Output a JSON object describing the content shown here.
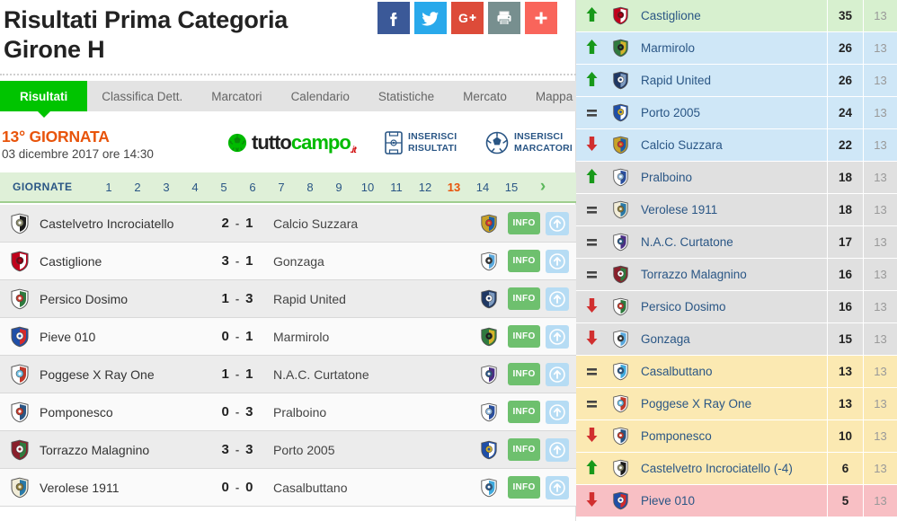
{
  "header": {
    "title_line1": "Risultati Prima Categoria",
    "title_line2": "Girone H",
    "social": [
      {
        "name": "facebook",
        "label": "f"
      },
      {
        "name": "twitter",
        "label": ""
      },
      {
        "name": "googleplus",
        "label": "G+"
      },
      {
        "name": "print",
        "label": ""
      },
      {
        "name": "share-more",
        "label": "+"
      }
    ]
  },
  "tabs": [
    {
      "label": "Risultati",
      "active": true
    },
    {
      "label": "Classifica Dett.",
      "active": false
    },
    {
      "label": "Marcatori",
      "active": false
    },
    {
      "label": "Calendario",
      "active": false
    },
    {
      "label": "Statistiche",
      "active": false
    },
    {
      "label": "Mercato",
      "active": false
    },
    {
      "label": "Mappa",
      "active": false
    }
  ],
  "matchday": {
    "number_label": "13° GIORNATA",
    "date_label": "03 dicembre 2017 ore 14:30",
    "logo_text_1": "tutto",
    "logo_text_2": "campo",
    "logo_suffix": ".it",
    "insert_results_line1": "INSERISCI",
    "insert_results_line2": "RISULTATI",
    "insert_scorers_line1": "INSERISCI",
    "insert_scorers_line2": "MARCATORI"
  },
  "giornate": {
    "label": "GIORNATE",
    "numbers": [
      "1",
      "2",
      "3",
      "4",
      "5",
      "6",
      "7",
      "8",
      "9",
      "10",
      "11",
      "12",
      "13",
      "14",
      "15"
    ],
    "current": "13",
    "next_icon": "›"
  },
  "matches": [
    {
      "home": "Castelvetro Incrociatello",
      "home_score": "2",
      "away_score": "1",
      "away": "Calcio Suzzara",
      "home_logo": {
        "c1": "#ffffff",
        "c2": "#1b1b1b",
        "c3": "#8a8a6a"
      },
      "away_logo": {
        "c1": "#c9a227",
        "c2": "#1b5fa8",
        "c3": "#d03030"
      },
      "info_label": "INFO"
    },
    {
      "home": "Castiglione",
      "home_score": "3",
      "away_score": "1",
      "away": "Gonzaga",
      "home_logo": {
        "c1": "#c2001b",
        "c2": "#ffffff",
        "c3": "#7a0010"
      },
      "away_logo": {
        "c1": "#ffffff",
        "c2": "#5aa9dd",
        "c3": "#333333"
      },
      "info_label": "INFO"
    },
    {
      "home": "Persico Dosimo",
      "home_score": "1",
      "away_score": "3",
      "away": "Rapid United",
      "home_logo": {
        "c1": "#ffffff",
        "c2": "#2f7a3e",
        "c3": "#c0392b"
      },
      "away_logo": {
        "c1": "#1f3864",
        "c2": "#7f9cc0",
        "c3": "#ffffff"
      },
      "info_label": "INFO"
    },
    {
      "home": "Pieve 010",
      "home_score": "0",
      "away_score": "1",
      "away": "Marmirolo",
      "home_logo": {
        "c1": "#1f4fa8",
        "c2": "#d42b2b",
        "c3": "#ffffff"
      },
      "away_logo": {
        "c1": "#2f7a3e",
        "c2": "#d4b32a",
        "c3": "#1b1b1b"
      },
      "info_label": "INFO"
    },
    {
      "home": "Poggese X Ray One",
      "home_score": "1",
      "away_score": "1",
      "away": "N.A.C. Curtatone",
      "home_logo": {
        "c1": "#ffffff",
        "c2": "#c0392b",
        "c3": "#6fc2e8"
      },
      "away_logo": {
        "c1": "#ffffff",
        "c2": "#4b2f86",
        "c3": "#2a5685"
      },
      "info_label": "INFO"
    },
    {
      "home": "Pomponesco",
      "home_score": "0",
      "away_score": "3",
      "away": "Pralboino",
      "home_logo": {
        "c1": "#ffffff",
        "c2": "#2a5685",
        "c3": "#c0392b"
      },
      "away_logo": {
        "c1": "#ffffff",
        "c2": "#2a4f9e",
        "c3": "#8fb8dd"
      },
      "info_label": "INFO"
    },
    {
      "home": "Torrazzo Malagnino",
      "home_score": "3",
      "away_score": "3",
      "away": "Porto 2005",
      "home_logo": {
        "c1": "#8a1f2b",
        "c2": "#2f7a3e",
        "c3": "#ffffff"
      },
      "away_logo": {
        "c1": "#1f4fa8",
        "c2": "#ffffff",
        "c3": "#d4b32a"
      },
      "info_label": "INFO"
    },
    {
      "home": "Verolese 1911",
      "home_score": "0",
      "away_score": "0",
      "away": "Casalbuttano",
      "home_logo": {
        "c1": "#f2edd8",
        "c2": "#2a7aa8",
        "c3": "#8a7a3a"
      },
      "away_logo": {
        "c1": "#ffffff",
        "c2": "#3fa9dd",
        "c3": "#2a5685"
      },
      "info_label": "INFO"
    }
  ],
  "standings": [
    {
      "trend": "up",
      "name": "Castiglione",
      "points": "35",
      "played": "13",
      "zone": "zg-green",
      "logo": {
        "c1": "#c2001b",
        "c2": "#ffffff",
        "c3": "#7a0010"
      }
    },
    {
      "trend": "up",
      "name": "Marmirolo",
      "points": "26",
      "played": "13",
      "zone": "zg-blue",
      "logo": {
        "c1": "#2f7a3e",
        "c2": "#d4b32a",
        "c3": "#1b1b1b"
      }
    },
    {
      "trend": "up",
      "name": "Rapid United",
      "points": "26",
      "played": "13",
      "zone": "zg-blue",
      "logo": {
        "c1": "#1f3864",
        "c2": "#7f9cc0",
        "c3": "#ffffff"
      }
    },
    {
      "trend": "eq",
      "name": "Porto 2005",
      "points": "24",
      "played": "13",
      "zone": "zg-blue",
      "logo": {
        "c1": "#1f4fa8",
        "c2": "#ffffff",
        "c3": "#d4b32a"
      }
    },
    {
      "trend": "down",
      "name": "Calcio Suzzara",
      "points": "22",
      "played": "13",
      "zone": "zg-blue",
      "logo": {
        "c1": "#c9a227",
        "c2": "#1b5fa8",
        "c3": "#d03030"
      }
    },
    {
      "trend": "up",
      "name": "Pralboino",
      "points": "18",
      "played": "13",
      "zone": "zg-grey",
      "logo": {
        "c1": "#ffffff",
        "c2": "#2a4f9e",
        "c3": "#8fb8dd"
      }
    },
    {
      "trend": "eq",
      "name": "Verolese 1911",
      "points": "18",
      "played": "13",
      "zone": "zg-grey",
      "logo": {
        "c1": "#f2edd8",
        "c2": "#2a7aa8",
        "c3": "#8a7a3a"
      }
    },
    {
      "trend": "eq",
      "name": "N.A.C. Curtatone",
      "points": "17",
      "played": "13",
      "zone": "zg-grey",
      "logo": {
        "c1": "#ffffff",
        "c2": "#4b2f86",
        "c3": "#2a5685"
      }
    },
    {
      "trend": "eq",
      "name": "Torrazzo Malagnino",
      "points": "16",
      "played": "13",
      "zone": "zg-grey",
      "logo": {
        "c1": "#8a1f2b",
        "c2": "#2f7a3e",
        "c3": "#ffffff"
      }
    },
    {
      "trend": "down",
      "name": "Persico Dosimo",
      "points": "16",
      "played": "13",
      "zone": "zg-grey",
      "logo": {
        "c1": "#ffffff",
        "c2": "#2f7a3e",
        "c3": "#c0392b"
      }
    },
    {
      "trend": "down",
      "name": "Gonzaga",
      "points": "15",
      "played": "13",
      "zone": "zg-grey",
      "logo": {
        "c1": "#ffffff",
        "c2": "#5aa9dd",
        "c3": "#333333"
      }
    },
    {
      "trend": "eq",
      "name": "Casalbuttano",
      "points": "13",
      "played": "13",
      "zone": "zg-yellow",
      "logo": {
        "c1": "#ffffff",
        "c2": "#3fa9dd",
        "c3": "#2a5685"
      }
    },
    {
      "trend": "eq",
      "name": "Poggese X Ray One",
      "points": "13",
      "played": "13",
      "zone": "zg-yellow",
      "logo": {
        "c1": "#ffffff",
        "c2": "#c0392b",
        "c3": "#6fc2e8"
      }
    },
    {
      "trend": "down",
      "name": "Pomponesco",
      "points": "10",
      "played": "13",
      "zone": "zg-yellow",
      "logo": {
        "c1": "#ffffff",
        "c2": "#2a5685",
        "c3": "#c0392b"
      }
    },
    {
      "trend": "up",
      "name": "Castelvetro Incrociatello (-4)",
      "points": "6",
      "played": "13",
      "zone": "zg-yellow",
      "logo": {
        "c1": "#ffffff",
        "c2": "#1b1b1b",
        "c3": "#8a8a6a"
      }
    },
    {
      "trend": "down",
      "name": "Pieve 010",
      "points": "5",
      "played": "13",
      "zone": "zg-red",
      "logo": {
        "c1": "#1f4fa8",
        "c2": "#d42b2b",
        "c3": "#ffffff"
      }
    }
  ]
}
